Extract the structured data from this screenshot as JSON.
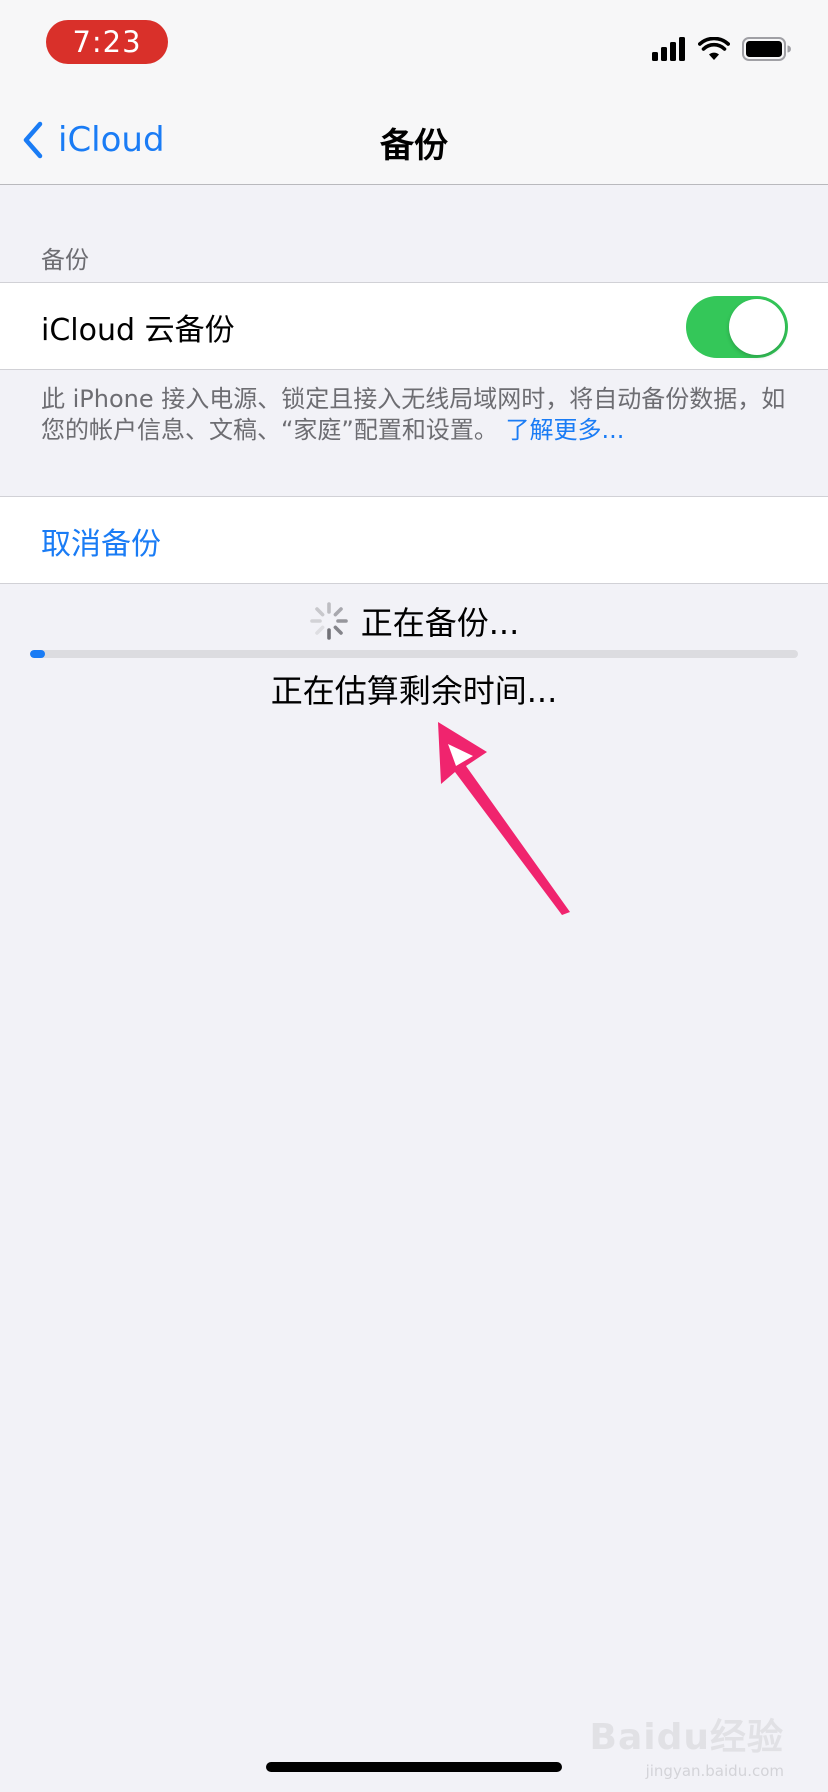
{
  "status_bar": {
    "time": "7:23",
    "icons": [
      "cellular-signal-icon",
      "wifi-icon",
      "battery-icon"
    ]
  },
  "nav": {
    "back_label": "iCloud",
    "title": "备份"
  },
  "backup_section": {
    "header": "备份",
    "toggle_label": "iCloud 云备份",
    "toggle_on": true,
    "footer_text": "此 iPhone 接入电源、锁定且接入无线局域网时，将自动备份数据，如您的帐户信息、文稿、“家庭”配置和设置。",
    "learn_more": "了解更多..."
  },
  "cancel_label": "取消备份",
  "progress": {
    "status": "正在备份...",
    "estimate": "正在估算剩余时间...",
    "fraction": 0.02
  },
  "watermark": {
    "main": "Baidu经验",
    "sub": "jingyan.baidu.com"
  },
  "colors": {
    "accent": "#1a7cf5",
    "toggle_on": "#34c759",
    "time_pill": "#d9302a",
    "annotation_arrow": "#f0246e"
  }
}
